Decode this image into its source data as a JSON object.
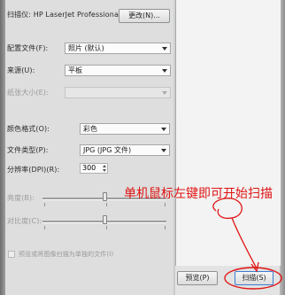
{
  "scanner": {
    "label": "扫描仪: HP LaserJet Professional...",
    "change_button": "更改(N)..."
  },
  "settings": {
    "profile": {
      "label": "配置文件(F):",
      "value": "照片 (默认)"
    },
    "source": {
      "label": "来源(U):",
      "value": "平板"
    },
    "paper_size": {
      "label": "纸张大小(E):",
      "value": ""
    },
    "color_format": {
      "label": "颜色格式(O):",
      "value": "彩色"
    },
    "file_type": {
      "label": "文件类型(P):",
      "value": "JPG (JPG 文件)"
    },
    "resolution": {
      "label": "分辨率(DPI)(R):",
      "value": "300"
    },
    "brightness": {
      "label": "亮度(B):",
      "level": 0
    },
    "contrast": {
      "label": "对比度(C):",
      "level": 0
    },
    "separate_files": {
      "label": "预览或将图像扫描为单独的文件(I)"
    }
  },
  "buttons": {
    "preview": "预览(P)",
    "scan": "扫描(S)"
  },
  "annotation": {
    "text": "单机鼠标左键即可开始扫描",
    "color": "#e01414"
  }
}
